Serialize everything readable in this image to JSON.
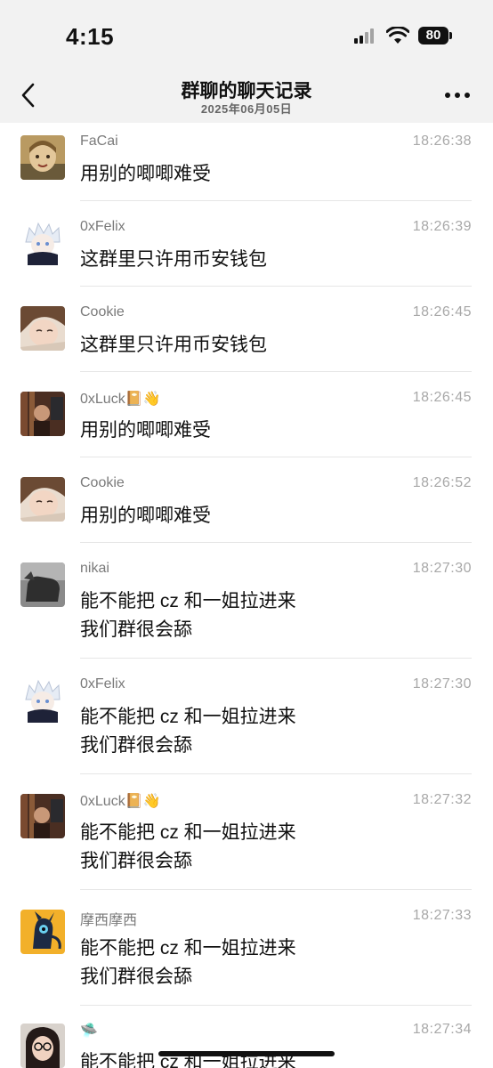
{
  "status_bar": {
    "time": "4:15",
    "battery": "80"
  },
  "nav": {
    "title": "群聊的聊天记录",
    "subtitle": "2025年06月05日"
  },
  "colors": {
    "background": "#ffffff",
    "bar": "#f2f2f2",
    "sender": "#7a7a7a",
    "timestamp": "#a8a8a8"
  },
  "messages": [
    {
      "sender": "FaCai",
      "time": "18:26:38",
      "lines": [
        "用别的唧唧难受"
      ],
      "avatar": "cartoon-girl-avatar"
    },
    {
      "sender": "0xFelix",
      "time": "18:26:39",
      "lines": [
        "这群里只许用币安钱包"
      ],
      "avatar": "anime-white-hair-avatar"
    },
    {
      "sender": "Cookie",
      "time": "18:26:45",
      "lines": [
        "这群里只许用币安钱包"
      ],
      "avatar": "photo-girl-avatar"
    },
    {
      "sender": "0xLuck📔👋",
      "time": "18:26:45",
      "lines": [
        "用别的唧唧难受"
      ],
      "avatar": "photo-room-avatar"
    },
    {
      "sender": "Cookie",
      "time": "18:26:52",
      "lines": [
        "用别的唧唧难受"
      ],
      "avatar": "photo-girl-avatar"
    },
    {
      "sender": "nikai",
      "time": "18:27:30",
      "lines": [
        "能不能把 cz 和一姐拉进来",
        "我们群很会舔"
      ],
      "avatar": "photo-horse-avatar"
    },
    {
      "sender": "0xFelix",
      "time": "18:27:30",
      "lines": [
        "能不能把 cz 和一姐拉进来",
        "我们群很会舔"
      ],
      "avatar": "anime-white-hair-avatar"
    },
    {
      "sender": "0xLuck📔👋",
      "time": "18:27:32",
      "lines": [
        "能不能把 cz 和一姐拉进来",
        "我们群很会舔"
      ],
      "avatar": "photo-room-avatar"
    },
    {
      "sender": "摩西摩西",
      "time": "18:27:33",
      "lines": [
        "能不能把 cz 和一姐拉进来",
        "我们群很会舔"
      ],
      "avatar": "cartoon-creature-avatar"
    },
    {
      "sender": "🛸",
      "time": "18:27:34",
      "lines": [
        "能不能把 cz 和一姐拉进来"
      ],
      "avatar": "photo-glasses-girl-avatar"
    }
  ]
}
